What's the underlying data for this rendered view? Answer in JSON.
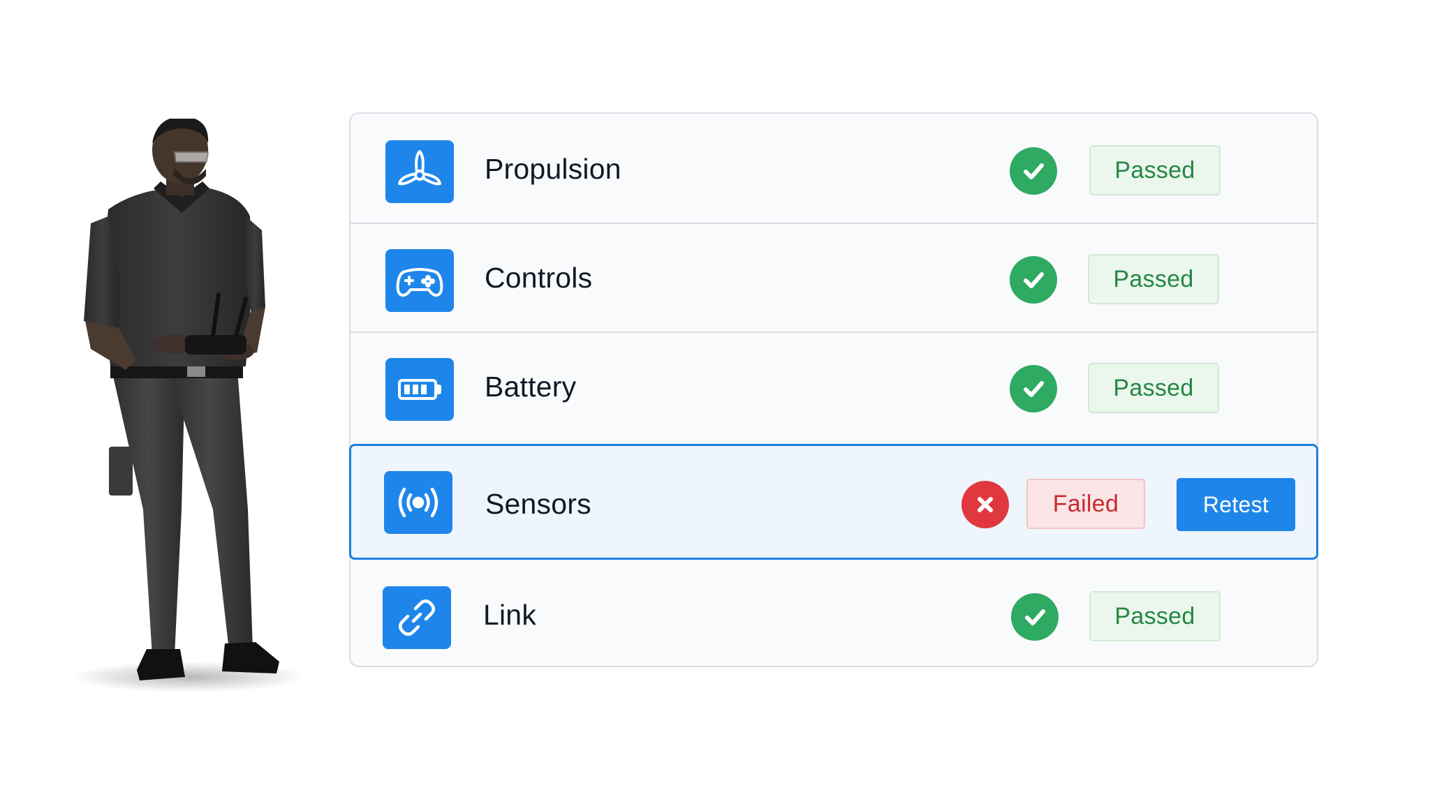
{
  "checklist": {
    "rows": [
      {
        "label": "Propulsion",
        "icon": "propeller-icon",
        "status_icon": "check-circle-icon",
        "status": "Passed"
      },
      {
        "label": "Controls",
        "icon": "gamepad-icon",
        "status_icon": "check-circle-icon",
        "status": "Passed"
      },
      {
        "label": "Battery",
        "icon": "battery-icon",
        "status_icon": "check-circle-icon",
        "status": "Passed"
      },
      {
        "label": "Sensors",
        "icon": "broadcast-icon",
        "status_icon": "x-circle-icon",
        "status": "Failed",
        "action": "Retest"
      },
      {
        "label": "Link",
        "icon": "link-icon",
        "status_icon": "check-circle-icon",
        "status": "Passed"
      }
    ]
  },
  "colors": {
    "accent": "#1e86ea",
    "pass_green": "#2eaa62",
    "fail_red": "#e0383e",
    "selected_border": "#1e7fe0"
  },
  "illustration": {
    "subject": "technician-holding-drone-controller-icon"
  }
}
